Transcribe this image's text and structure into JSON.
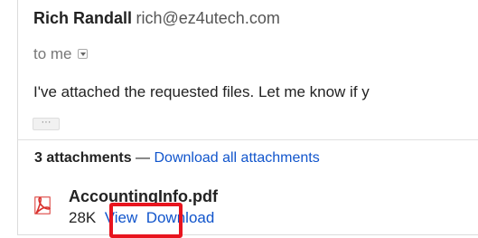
{
  "sender": {
    "name": "Rich Randall",
    "email": "rich@ez4utech.com"
  },
  "recipient": {
    "label": "to me"
  },
  "message": {
    "snippet": "I've attached the requested files. Let me know if y"
  },
  "ellipsis": "···",
  "attachments": {
    "count_label": "3 attachments",
    "separator": "—",
    "download_all_label": "Download all attachments",
    "items": [
      {
        "filename": "AccountingInfo.pdf",
        "size": "28K",
        "view_label": "View",
        "download_label": "Download",
        "icon": "pdf-icon"
      }
    ]
  },
  "colors": {
    "link": "#1155cc",
    "highlight": "#e8141e",
    "pdf": "#d9302c"
  }
}
